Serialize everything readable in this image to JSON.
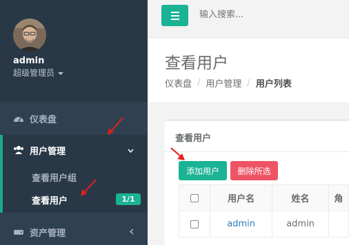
{
  "sidebar": {
    "profile": {
      "name": "admin",
      "role": "超级管理员"
    },
    "items": [
      {
        "label": "仪表盘",
        "icon": "dashboard-icon"
      },
      {
        "label": "用户管理",
        "icon": "users-icon",
        "expanded": true
      },
      {
        "label": "资产管理",
        "icon": "hdd-icon"
      }
    ],
    "subitems": [
      {
        "label": "查看用户组"
      },
      {
        "label": "查看用户",
        "badge": "1/1",
        "active": true
      }
    ]
  },
  "topbar": {
    "search_placeholder": "输入搜索..."
  },
  "heading": {
    "title": "查看用户",
    "breadcrumb": [
      "仪表盘",
      "用户管理",
      "用户列表"
    ]
  },
  "ibox": {
    "title": "查看用户"
  },
  "buttons": {
    "add": "添加用户",
    "delete_selected": "删除所选"
  },
  "table": {
    "headers": [
      "",
      "用户名",
      "姓名",
      "角"
    ],
    "rows": [
      {
        "username": "admin",
        "name": "admin"
      }
    ]
  },
  "colors": {
    "accent": "#1ab394",
    "danger": "#ed5565",
    "sidebar": "#2f4050"
  }
}
